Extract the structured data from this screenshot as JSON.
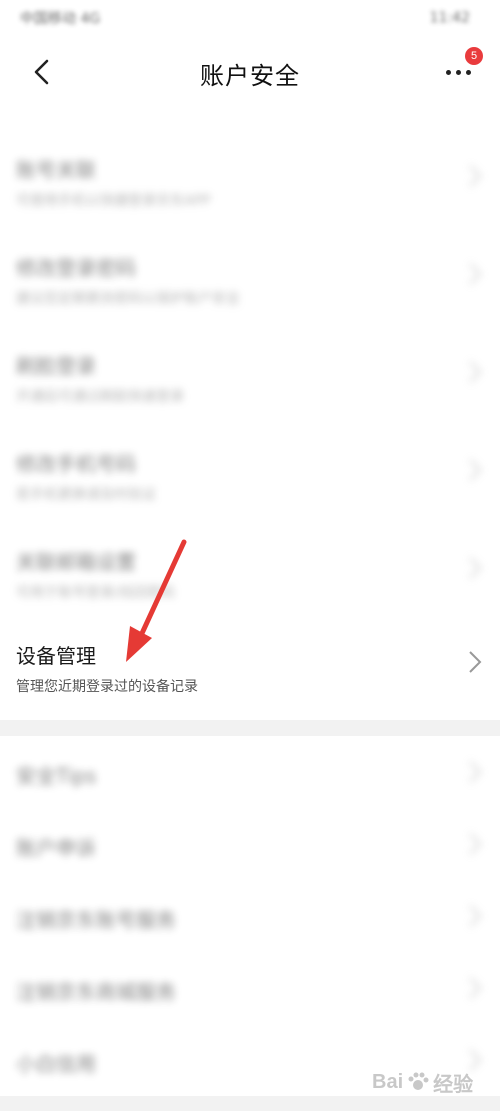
{
  "status_bar": {
    "carrier": "中国移动 4G",
    "time": "11:42"
  },
  "header": {
    "title": "账户安全",
    "badge_count": "5",
    "back_icon": "chevron-left-icon",
    "more_icon": "more-dots-icon"
  },
  "group1": {
    "top_stub_subtitle": "",
    "items": [
      {
        "title": "账号关联",
        "subtitle": "可使用手机以快捷登录京东APP",
        "value": "",
        "blurred": true
      },
      {
        "title": "修改登录密码",
        "subtitle": "建议您定期更改密码以保护账户安全",
        "value": "",
        "blurred": true
      },
      {
        "title": "刷脸登录",
        "subtitle": "开通后可通过刷脸快速登录",
        "value": "",
        "blurred": true
      },
      {
        "title": "修改手机号码",
        "subtitle": "若手机更换请及时验证",
        "value": "",
        "blurred": true
      },
      {
        "title": "关联邮箱设置",
        "subtitle": "可用于账号登录/找回密码",
        "value": "",
        "blurred": true
      },
      {
        "title": "设备管理",
        "subtitle": "管理您近期登录过的设备记录",
        "value": "",
        "blurred": false
      }
    ]
  },
  "group2": {
    "items": [
      {
        "title": "安全Tips",
        "value": ""
      },
      {
        "title": "账户申诉",
        "value": ""
      },
      {
        "title": "注销京东账号服务",
        "value": ""
      },
      {
        "title": "注销京东商城服务",
        "value": ""
      },
      {
        "title": "小白信用",
        "value": ""
      }
    ]
  },
  "watermark": {
    "logo_text": "Bai",
    "brand_text": "经验"
  },
  "colors": {
    "badge": "#e93b3d",
    "annotation_arrow": "#e53a35",
    "background": "#f2f2f2"
  }
}
